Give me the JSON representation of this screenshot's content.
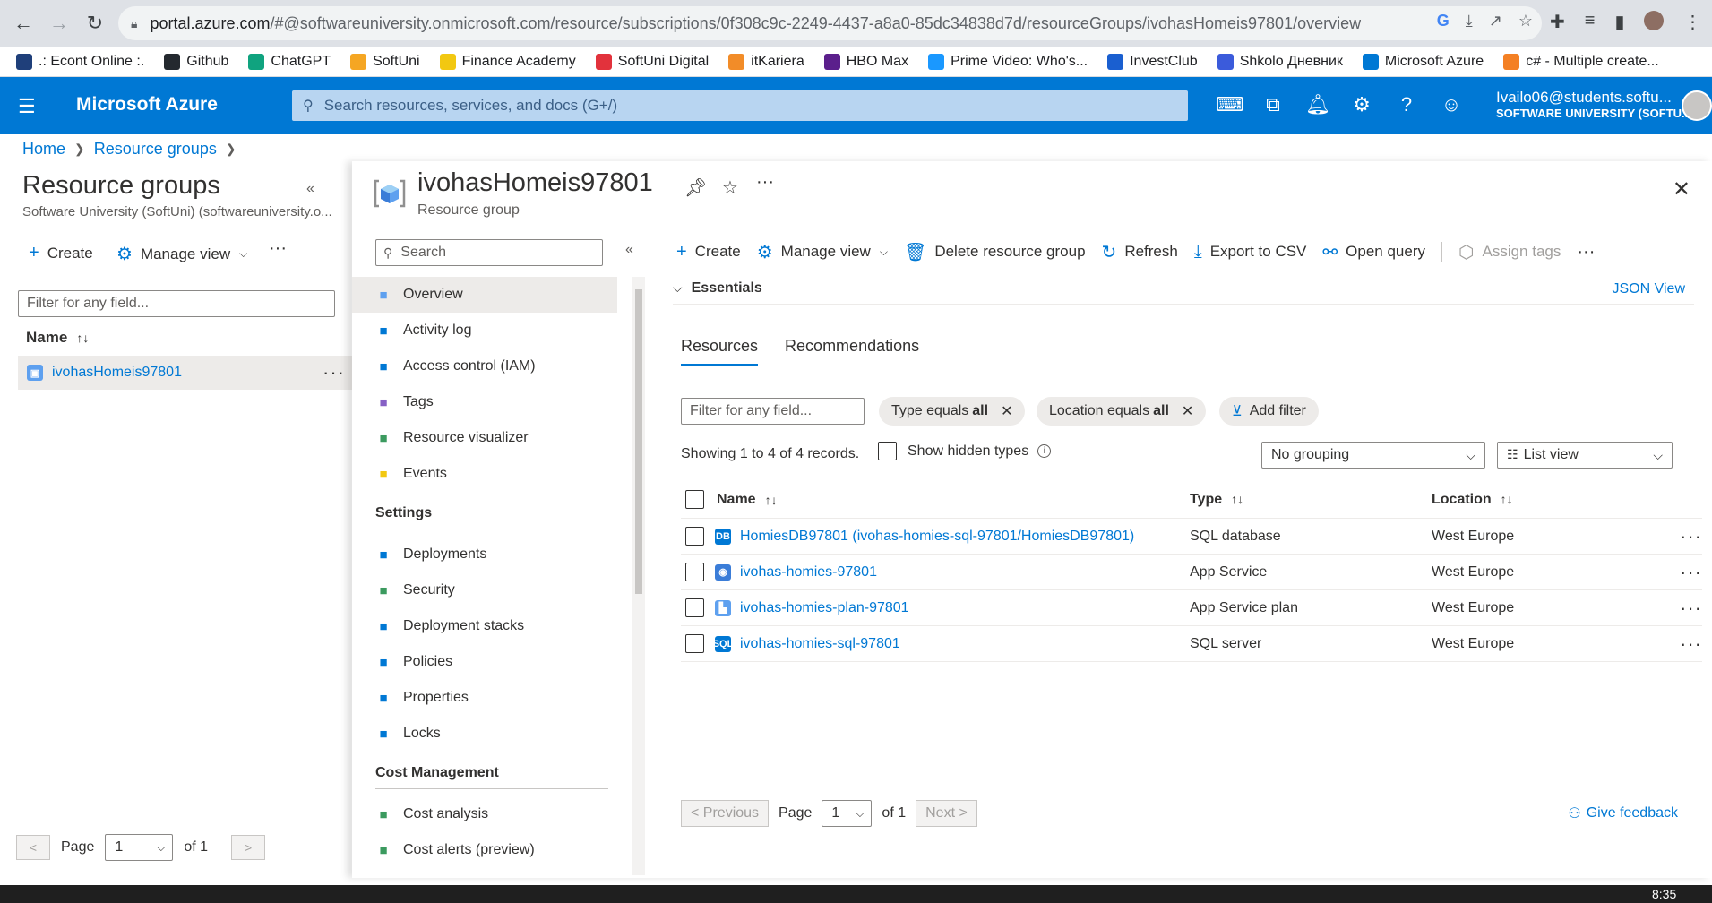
{
  "browser": {
    "url_host": "portal.azure.com",
    "url_path": "/#@softwareuniversity.onmicrosoft.com/resource/subscriptions/0f308c9c-2249-4437-a8a0-85dc34838d7d/resourceGroups/ivohasHomeis97801/overview"
  },
  "bookmarks": [
    {
      "label": ".: Econt Online :.",
      "color": "#1f3f7a"
    },
    {
      "label": "Github",
      "color": "#24292f"
    },
    {
      "label": "ChatGPT",
      "color": "#10a37f"
    },
    {
      "label": "SoftUni",
      "color": "#f5a623"
    },
    {
      "label": "Finance Academy",
      "color": "#f2c811"
    },
    {
      "label": "SoftUni Digital",
      "color": "#e2323c"
    },
    {
      "label": "itKariera",
      "color": "#f28c28"
    },
    {
      "label": "HBO Max",
      "color": "#5b1f8c"
    },
    {
      "label": "Prime Video: Who's...",
      "color": "#1a98ff"
    },
    {
      "label": "InvestClub",
      "color": "#1a5fd0"
    },
    {
      "label": "Shkolo Дневник",
      "color": "#3b5bdb"
    },
    {
      "label": "Microsoft Azure",
      "color": "#0078d4"
    },
    {
      "label": "c# - Multiple create...",
      "color": "#f48024"
    }
  ],
  "header": {
    "brand": "Microsoft Azure",
    "search_placeholder": "Search resources, services, and docs (G+/)",
    "account_email": "Ivailo06@students.softu...",
    "account_tenant": "SOFTWARE UNIVERSITY (SOFTU..."
  },
  "breadcrumb": {
    "home": "Home",
    "resource_groups": "Resource groups"
  },
  "left_panel": {
    "title": "Resource groups",
    "subtitle": "Software University (SoftUni) (softwareuniversity.o...",
    "create": "Create",
    "manage_view": "Manage view",
    "filter_placeholder": "Filter for any field...",
    "name_header": "Name",
    "rows": [
      {
        "name": "ivohasHomeis97801"
      }
    ],
    "page_label": "Page",
    "page_value": "1",
    "of_label": "of 1"
  },
  "blade": {
    "title": "ivohasHomeis97801",
    "subtitle": "Resource group",
    "menu_search": "Search",
    "menu": [
      {
        "label": "Overview",
        "icon": "overview-icon",
        "color": "#5ea0ef",
        "active": true
      },
      {
        "label": "Activity log",
        "icon": "activity-log-icon",
        "color": "#0078d4"
      },
      {
        "label": "Access control (IAM)",
        "icon": "iam-icon",
        "color": "#0078d4"
      },
      {
        "label": "Tags",
        "icon": "tag-icon",
        "color": "#8661c5"
      },
      {
        "label": "Resource visualizer",
        "icon": "visualizer-icon",
        "color": "#3b9a5f"
      },
      {
        "label": "Events",
        "icon": "lightning-icon",
        "color": "#f2c811"
      }
    ],
    "settings_heading": "Settings",
    "settings": [
      {
        "label": "Deployments",
        "icon": "deployments-icon",
        "color": "#0078d4"
      },
      {
        "label": "Security",
        "icon": "security-icon",
        "color": "#3b9a5f"
      },
      {
        "label": "Deployment stacks",
        "icon": "deployment-stacks-icon",
        "color": "#0078d4"
      },
      {
        "label": "Policies",
        "icon": "policies-icon",
        "color": "#0078d4"
      },
      {
        "label": "Properties",
        "icon": "properties-icon",
        "color": "#0078d4"
      },
      {
        "label": "Locks",
        "icon": "lock-icon",
        "color": "#0078d4"
      }
    ],
    "cost_heading": "Cost Management",
    "cost": [
      {
        "label": "Cost analysis",
        "icon": "cost-analysis-icon",
        "color": "#3b9a5f"
      },
      {
        "label": "Cost alerts (preview)",
        "icon": "cost-alerts-icon",
        "color": "#3b9a5f"
      }
    ]
  },
  "toolbar": {
    "create": "Create",
    "manage_view": "Manage view",
    "delete": "Delete resource group",
    "refresh": "Refresh",
    "export": "Export to CSV",
    "open_query": "Open query",
    "assign_tags": "Assign tags"
  },
  "essentials": {
    "label": "Essentials",
    "json_view": "JSON View"
  },
  "tabs": {
    "resources": "Resources",
    "recommendations": "Recommendations"
  },
  "filters": {
    "placeholder": "Filter for any field...",
    "type_label": "Type equals",
    "type_value": "all",
    "location_label": "Location equals",
    "location_value": "all",
    "add_filter": "Add filter"
  },
  "records": {
    "showing": "Showing 1 to 4 of 4 records.",
    "show_hidden": "Show hidden types",
    "grouping": "No grouping",
    "view": "List view"
  },
  "table": {
    "headers": {
      "name": "Name",
      "type": "Type",
      "location": "Location"
    },
    "rows": [
      {
        "name": "HomiesDB97801 (ivohas-homies-sql-97801/HomiesDB97801)",
        "type": "SQL database",
        "location": "West Europe",
        "icon": "sql-database-icon",
        "color": "#0078d4",
        "glyph": "DB"
      },
      {
        "name": "ivohas-homies-97801",
        "type": "App Service",
        "location": "West Europe",
        "icon": "app-service-icon",
        "color": "#3b7dd8",
        "glyph": "◉"
      },
      {
        "name": "ivohas-homies-plan-97801",
        "type": "App Service plan",
        "location": "West Europe",
        "icon": "app-service-plan-icon",
        "color": "#5ea0ef",
        "glyph": "▙"
      },
      {
        "name": "ivohas-homies-sql-97801",
        "type": "SQL server",
        "location": "West Europe",
        "icon": "sql-server-icon",
        "color": "#0078d4",
        "glyph": "SQL"
      }
    ]
  },
  "pager": {
    "previous": "< Previous",
    "page": "Page",
    "page_value": "1",
    "of": "of 1",
    "next": "Next >",
    "feedback": "Give feedback"
  },
  "taskbar": {
    "time": "8:35"
  }
}
